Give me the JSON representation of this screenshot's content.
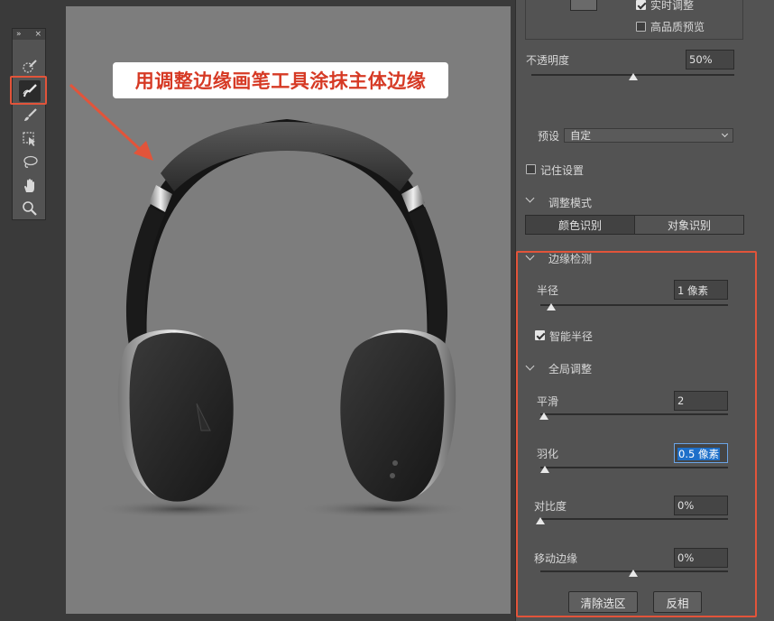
{
  "annotation": {
    "text": "用调整边缘画笔工具涂抹主体边缘"
  },
  "top_box": {
    "realtime_label": "实时调整",
    "realtime_checked": true,
    "hq_preview_label": "高品质预览",
    "hq_preview_checked": false
  },
  "opacity": {
    "label": "不透明度",
    "value": "50%",
    "level_fraction": 0.5
  },
  "preset": {
    "label": "预设",
    "value": "自定"
  },
  "remember": {
    "label": "记住设置",
    "checked": false
  },
  "adjust_mode": {
    "title": "调整模式",
    "options": [
      "颜色识别",
      "对象识别"
    ]
  },
  "edge_detection": {
    "title": "边缘检测",
    "radius_label": "半径",
    "radius_value": "1 像素",
    "smart_radius_label": "智能半径",
    "smart_radius_checked": true
  },
  "global_refine": {
    "title": "全局调整",
    "smooth_label": "平滑",
    "smooth_value": "2",
    "feather_label": "羽化",
    "feather_value": "0.5 像素",
    "contrast_label": "对比度",
    "contrast_value": "0%",
    "shift_edge_label": "移动边缘",
    "shift_edge_value": "0%"
  },
  "buttons": {
    "clear": "清除选区",
    "invert": "反相"
  },
  "toolbar": {
    "collapse_glyph": "»",
    "close_glyph": "×",
    "tools": [
      "quick-selection-tool",
      "refine-edge-brush-tool",
      "brush-tool",
      "object-selection-tool",
      "lasso-tool",
      "hand-tool",
      "zoom-tool"
    ],
    "active_tool": "refine-edge-brush-tool"
  },
  "colors": {
    "accent_red": "#e2543a",
    "selection_blue": "#1e6fc9"
  }
}
